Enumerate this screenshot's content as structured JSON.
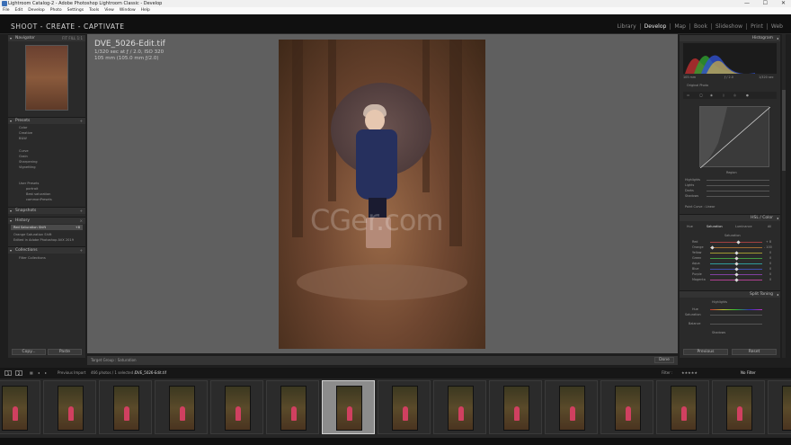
{
  "window": {
    "title": "Lightroom Catalog-2 - Adobe Photoshop Lightroom Classic - Develop",
    "controls": [
      "—",
      "☐",
      "✕"
    ]
  },
  "menu": [
    "File",
    "Edit",
    "Develop",
    "Photo",
    "Settings",
    "Tools",
    "View",
    "Window",
    "Help"
  ],
  "identity_plate": "SHOOT - CREATE - CAPTIVATE",
  "modules": [
    {
      "label": "Library",
      "active": false
    },
    {
      "label": "Develop",
      "active": true
    },
    {
      "label": "Map",
      "active": false
    },
    {
      "label": "Book",
      "active": false
    },
    {
      "label": "Slideshow",
      "active": false
    },
    {
      "label": "Print",
      "active": false
    },
    {
      "label": "Web",
      "active": false
    }
  ],
  "left_panel": {
    "navigator": {
      "title": "Navigator",
      "zoom": [
        "FIT",
        "FILL",
        "1:1"
      ]
    },
    "presets": {
      "title": "Presets",
      "items": [
        "Color",
        "Creative",
        "B&W",
        "Curve",
        "Grain",
        "Sharpening",
        "Vignetting",
        "User Presets",
        "portrait",
        "Best saturation",
        "commonPresets"
      ]
    },
    "snapshots": {
      "title": "Snapshots"
    },
    "history": {
      "title": "History",
      "items": [
        {
          "label": "Red Saturation Shift",
          "value": "+8",
          "selected": true
        },
        {
          "label": "Orange Saturation Shift",
          "value": "",
          "selected": false
        },
        {
          "label": "Edited in Adobe Photoshop AVX 2019",
          "value": "",
          "selected": false
        }
      ]
    },
    "collections": {
      "title": "Collections",
      "items": [
        "Filter Collections"
      ]
    },
    "copy_label": "Copy...",
    "paste_label": "Paste"
  },
  "photo_info": {
    "filename": "DVE_5026-Edit.tif",
    "exposure": "1/320 sec at ƒ / 2.0, ISO 320",
    "lens": "105 mm (105.0 mm ƒ/2.0)"
  },
  "watermark": "CGer.com",
  "right_panel": {
    "histogram": {
      "title": "Histogram",
      "readout": [
        "105 mm",
        "ƒ / 2.0",
        "1/320 sec"
      ],
      "original_photo_label": "Original Photo"
    },
    "tone_curve": {
      "region": "Region",
      "sliders": [
        "Highlights",
        "Lights",
        "Darks",
        "Shadows"
      ],
      "point_curve_label": "Point Curve :",
      "point_curve_value": "Linear"
    },
    "hsl": {
      "title": "HSL / Color",
      "tabs": [
        "Hue",
        "Saturation",
        "Luminance",
        "All"
      ],
      "active_tab": "Saturation",
      "section_label": "Saturation",
      "rows": [
        {
          "label": "Red",
          "value": "+ 8"
        },
        {
          "label": "Orange",
          "value": "- 100"
        },
        {
          "label": "Yellow",
          "value": "0"
        },
        {
          "label": "Green",
          "value": "0"
        },
        {
          "label": "Aqua",
          "value": "0"
        },
        {
          "label": "Blue",
          "value": "0"
        },
        {
          "label": "Purple",
          "value": "0"
        },
        {
          "label": "Magenta",
          "value": "0"
        }
      ]
    },
    "split_toning": {
      "title": "Split Toning",
      "highlights": "Highlights",
      "hue": "Hue",
      "saturation": "Saturation",
      "balance": "Balance",
      "shadows": "Shadows"
    },
    "previous_label": "Previous",
    "reset_label": "Reset"
  },
  "toolbar": {
    "label": "Target Group :",
    "value": "Saturation",
    "done_label": "Done"
  },
  "filmstrip_bar": {
    "pages": [
      "1",
      "2"
    ],
    "source": "Previous Import",
    "count": "466 photos / 1 selected /",
    "selected_file": "DVE_5026-Edit.tif",
    "filter_label": "Filter :",
    "filter_value": "No Filter"
  },
  "filmstrip": {
    "count": 15,
    "selected_index": 6
  }
}
